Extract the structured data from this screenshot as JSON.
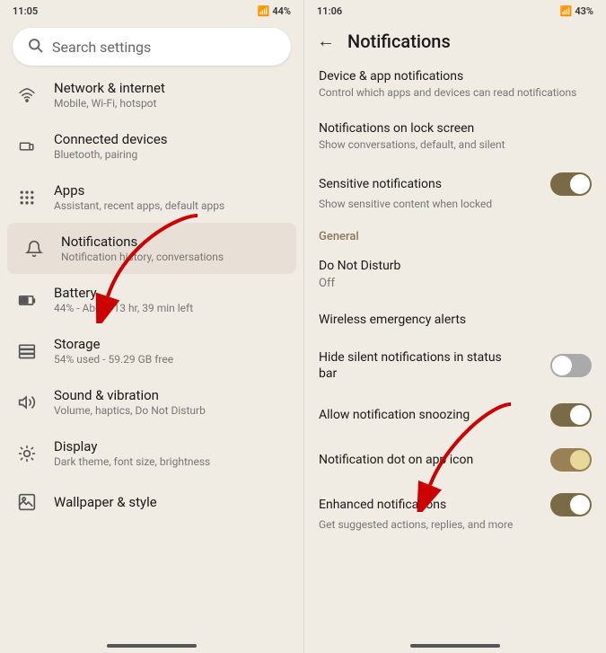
{
  "left": {
    "status": {
      "time": "11:05",
      "battery": "44%"
    },
    "search": {
      "placeholder": "Search settings"
    },
    "items": [
      {
        "id": "network",
        "icon": "wifi",
        "title": "Network & internet",
        "subtitle": "Mobile, Wi-Fi, hotspot"
      },
      {
        "id": "connected",
        "icon": "devices",
        "title": "Connected devices",
        "subtitle": "Bluetooth, pairing"
      },
      {
        "id": "apps",
        "icon": "apps",
        "title": "Apps",
        "subtitle": "Assistant, recent apps, default apps"
      },
      {
        "id": "notifications",
        "icon": "bell",
        "title": "Notifications",
        "subtitle": "Notification history, conversations",
        "active": true
      },
      {
        "id": "battery",
        "icon": "battery",
        "title": "Battery",
        "subtitle": "44% - About 13 hr, 39 min left"
      },
      {
        "id": "storage",
        "icon": "storage",
        "title": "Storage",
        "subtitle": "54% used - 59.29 GB free"
      },
      {
        "id": "sound",
        "icon": "volume",
        "title": "Sound & vibration",
        "subtitle": "Volume, haptics, Do Not Disturb"
      },
      {
        "id": "display",
        "icon": "display",
        "title": "Display",
        "subtitle": "Dark theme, font size, brightness"
      },
      {
        "id": "wallpaper",
        "icon": "wallpaper",
        "title": "Wallpaper & style",
        "subtitle": ""
      }
    ]
  },
  "right": {
    "status": {
      "time": "11:06",
      "battery": "43%"
    },
    "header": {
      "title": "Notifications",
      "back": "←"
    },
    "sections": [
      {
        "items": [
          {
            "id": "device-app",
            "title": "Device & app notifications",
            "subtitle": "Control which apps and devices can read notifications",
            "hasToggle": false
          },
          {
            "id": "lock-screen",
            "title": "Notifications on lock screen",
            "subtitle": "Show conversations, default, and silent",
            "hasToggle": false
          },
          {
            "id": "sensitive",
            "title": "Sensitive notifications",
            "subtitle": "Show sensitive content when locked",
            "hasToggle": true,
            "toggleState": "on"
          }
        ]
      },
      {
        "label": "General",
        "items": [
          {
            "id": "dnd",
            "title": "Do Not Disturb",
            "subtitle": "Off",
            "hasToggle": false
          },
          {
            "id": "emergency",
            "title": "Wireless emergency alerts",
            "subtitle": "",
            "hasToggle": false
          },
          {
            "id": "hide-silent",
            "title": "Hide silent notifications in status bar",
            "subtitle": "",
            "hasToggle": true,
            "toggleState": "off"
          },
          {
            "id": "snoozing",
            "title": "Allow notification snoozing",
            "subtitle": "",
            "hasToggle": true,
            "toggleState": "on"
          },
          {
            "id": "dot",
            "title": "Notification dot on app icon",
            "subtitle": "",
            "hasToggle": true,
            "toggleState": "on-partial"
          },
          {
            "id": "enhanced",
            "title": "Enhanced notifications",
            "subtitle": "Get suggested actions, replies, and more",
            "hasToggle": true,
            "toggleState": "on"
          }
        ]
      }
    ]
  }
}
